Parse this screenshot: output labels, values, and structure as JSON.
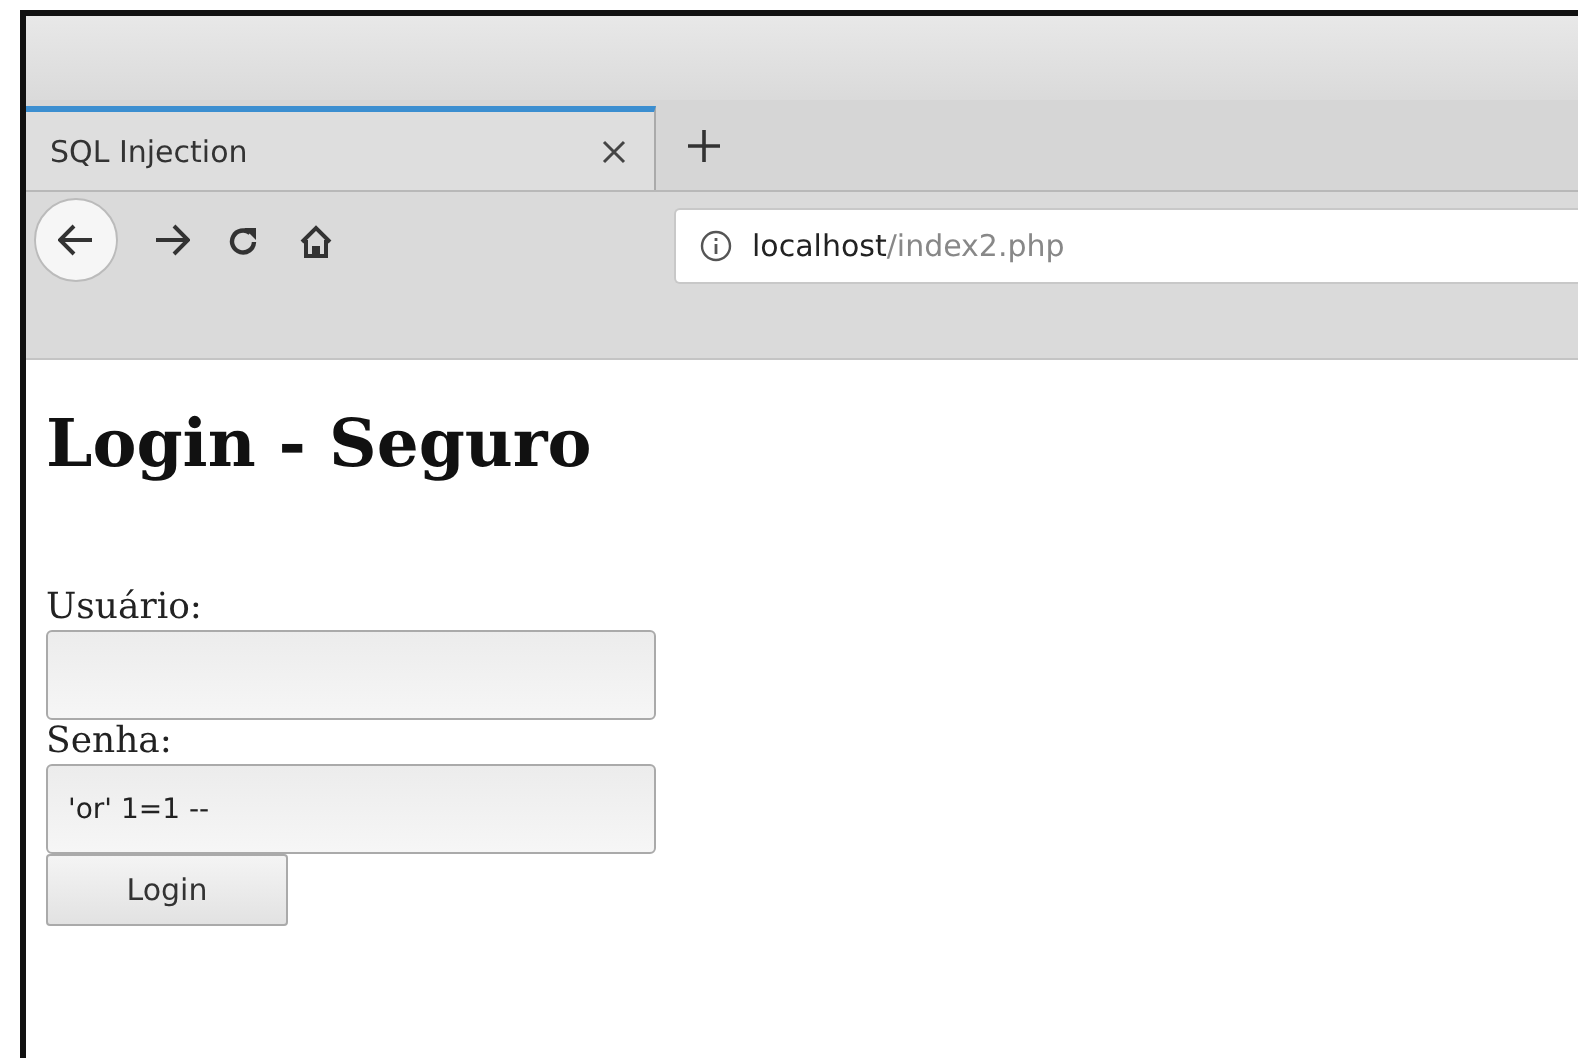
{
  "browser": {
    "tabs": [
      {
        "title": "SQL Injection",
        "selected": true
      }
    ],
    "address": {
      "host": "localhost",
      "path": "/index2.php"
    }
  },
  "page": {
    "heading": "Login - Seguro",
    "fields": [
      {
        "label": "Usuário:"
      },
      {
        "label": "Senha:",
        "value": "'or' 1=1 --"
      }
    ],
    "button": "Login"
  }
}
